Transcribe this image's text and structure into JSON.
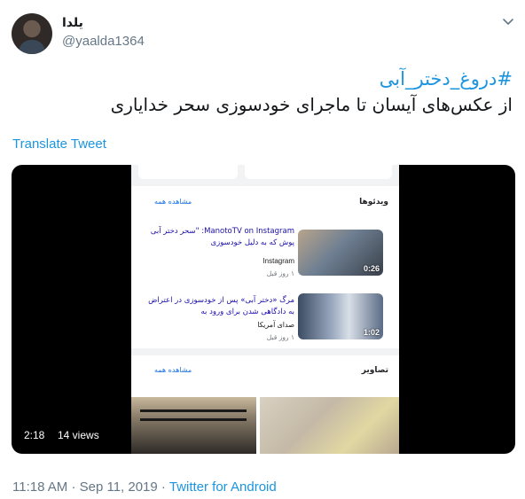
{
  "author": {
    "display_name": "یلدا",
    "handle": "@yaalda1364"
  },
  "tweet": {
    "hashtag": "#دروغ_دختر_آبی",
    "text": "از عکس‌های آیسان تا ماجرای خودسوزی سحر خدایاری",
    "translate_label": "Translate Tweet"
  },
  "video": {
    "elapsed": "2:18",
    "views": "14 views",
    "screen": {
      "videos_section": {
        "title": "ویدئوها",
        "see_all": "مشاهده همه",
        "items": [
          {
            "title": "ManotoTV on Instagram: \"سحر دختر آبی پوش که به دلیل خودسوزی",
            "source": "Instagram",
            "date": "۱ روز قبل",
            "duration": "0:26"
          },
          {
            "title": "مرگ «دختر آبی» پس از خودسوزی در اعتراض به دادگاهی شدن برای ورود به",
            "source": "صدای آمریکا",
            "date": "۱ روز قبل",
            "duration": "1:02"
          }
        ]
      },
      "images_section": {
        "title": "تصاویر",
        "see_all": "مشاهده همه"
      }
    }
  },
  "footer": {
    "time": "11:18 AM",
    "date": "Sep 11, 2019",
    "separator": "·",
    "source": "Twitter for Android"
  }
}
